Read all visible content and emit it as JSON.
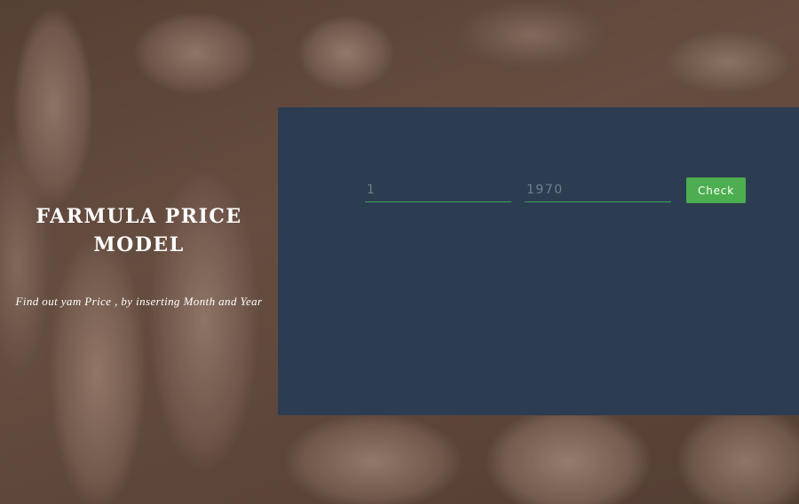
{
  "background": {
    "image": "yam-pile-photo"
  },
  "brand": {
    "title": "FARMULA PRICE MODEL",
    "subtitle": "Find out yam Price , by inserting Month and Year"
  },
  "form": {
    "month": {
      "placeholder": "1"
    },
    "year": {
      "placeholder": "1970"
    },
    "check_label": "Check"
  },
  "colors": {
    "panel": "#2c3d52",
    "accent": "#4cae50",
    "underline": "#3fa05a"
  }
}
